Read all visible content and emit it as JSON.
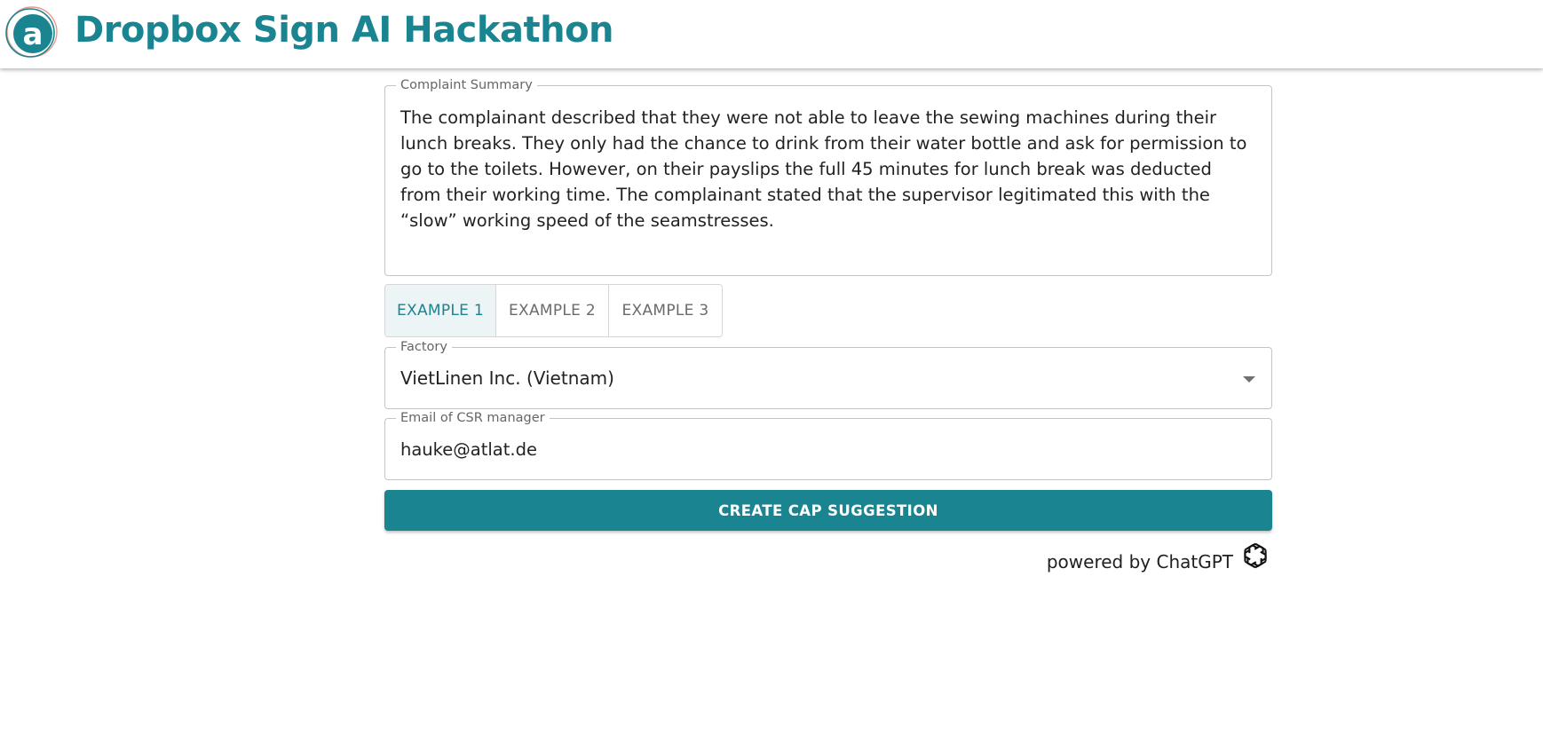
{
  "header": {
    "title": "Dropbox Sign AI Hackathon",
    "logo_letter": "a",
    "accent_color": "#1b8491"
  },
  "complaint": {
    "label": "Complaint Summary",
    "text": "The complainant described that they were not able to leave the sewing machines during their lunch breaks. They only had the chance to drink from their water bottle and ask for permission to go to the toilets. However, on their payslips the full 45 minutes for lunch break was deducted from their working time. The complainant stated that the supervisor legitimated this with the “slow” working speed of the seamstresses."
  },
  "examples": {
    "tabs": [
      {
        "label": "EXAMPLE 1",
        "selected": true
      },
      {
        "label": "EXAMPLE 2",
        "selected": false
      },
      {
        "label": "EXAMPLE 3",
        "selected": false
      }
    ]
  },
  "factory": {
    "label": "Factory",
    "value": "VietLinen Inc. (Vietnam)",
    "icon": "chevron-down-icon"
  },
  "email": {
    "label": "Email of CSR manager",
    "value": "hauke@atlat.de"
  },
  "actions": {
    "create_label": "CREATE CAP SUGGESTION"
  },
  "footer": {
    "powered_text": "powered by ChatGPT",
    "icon": "openai-logo-icon"
  }
}
